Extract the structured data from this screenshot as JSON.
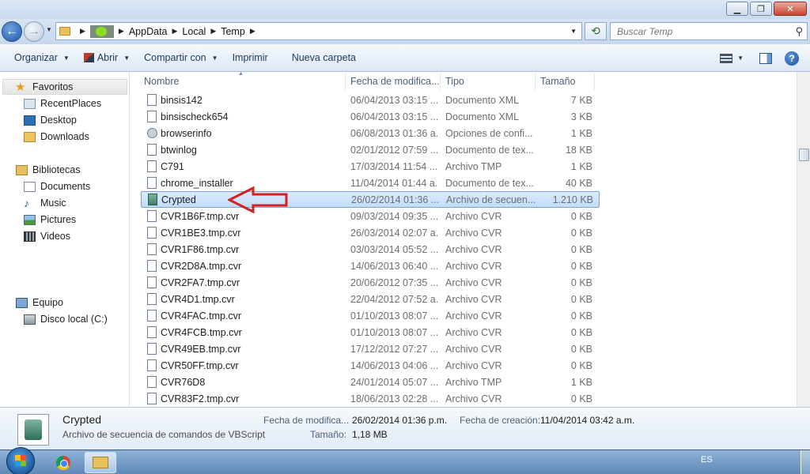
{
  "window": {
    "controls": [
      "minimize",
      "maximize",
      "close"
    ]
  },
  "address": {
    "crumbs": [
      "AppData",
      "Local",
      "Temp"
    ],
    "search_placeholder": "Buscar Temp"
  },
  "toolbar": {
    "organizar": "Organizar",
    "abrir": "Abrir",
    "compartir": "Compartir con",
    "imprimir": "Imprimir",
    "nueva_carpeta": "Nueva carpeta"
  },
  "nav": {
    "favoritos": "Favoritos",
    "recent": "RecentPlaces",
    "desktop": "Desktop",
    "downloads": "Downloads",
    "bibliotecas": "Bibliotecas",
    "documents": "Documents",
    "music": "Music",
    "pictures": "Pictures",
    "videos": "Videos",
    "equipo": "Equipo",
    "disco": "Disco local (C:)"
  },
  "columns": {
    "name": "Nombre",
    "date": "Fecha de modifica...",
    "type": "Tipo",
    "size": "Tamaño"
  },
  "files": [
    {
      "name": "binsis142",
      "date": "06/04/2013 03:15 ...",
      "type": "Documento XML",
      "size": "7 KB",
      "icon": "xml-file-icon"
    },
    {
      "name": "binsischeck654",
      "date": "06/04/2013 03:15 ...",
      "type": "Documento XML",
      "size": "3 KB",
      "icon": "xml-file-icon"
    },
    {
      "name": "browserinfo",
      "date": "06/08/2013 01:36 a...",
      "type": "Opciones de confi...",
      "size": "1 KB",
      "icon": "config-file-icon"
    },
    {
      "name": "btwinlog",
      "date": "02/01/2012 07:59 ...",
      "type": "Documento de tex...",
      "size": "18 KB",
      "icon": "text-file-icon"
    },
    {
      "name": "C791",
      "date": "17/03/2014 11:54 ...",
      "type": "Archivo TMP",
      "size": "1 KB",
      "icon": "tmp-file-icon"
    },
    {
      "name": "chrome_installer",
      "date": "11/04/2014 01:44 a...",
      "type": "Documento de tex...",
      "size": "40 KB",
      "icon": "text-file-icon"
    },
    {
      "name": "Crypted",
      "date": "26/02/2014 01:36 ...",
      "type": "Archivo de secuen...",
      "size": "1.210 KB",
      "icon": "vbscript-file-icon"
    },
    {
      "name": "CVR1B6F.tmp.cvr",
      "date": "09/03/2014 09:35 ...",
      "type": "Archivo CVR",
      "size": "0 KB",
      "icon": "blank-file-icon"
    },
    {
      "name": "CVR1BE3.tmp.cvr",
      "date": "26/03/2014 02:07 a...",
      "type": "Archivo CVR",
      "size": "0 KB",
      "icon": "blank-file-icon"
    },
    {
      "name": "CVR1F86.tmp.cvr",
      "date": "03/03/2014 05:52 ...",
      "type": "Archivo CVR",
      "size": "0 KB",
      "icon": "blank-file-icon"
    },
    {
      "name": "CVR2D8A.tmp.cvr",
      "date": "14/06/2013 06:40 ...",
      "type": "Archivo CVR",
      "size": "0 KB",
      "icon": "blank-file-icon"
    },
    {
      "name": "CVR2FA7.tmp.cvr",
      "date": "20/06/2012 07:35 ...",
      "type": "Archivo CVR",
      "size": "0 KB",
      "icon": "blank-file-icon"
    },
    {
      "name": "CVR4D1.tmp.cvr",
      "date": "22/04/2012 07:52 a...",
      "type": "Archivo CVR",
      "size": "0 KB",
      "icon": "blank-file-icon"
    },
    {
      "name": "CVR4FAC.tmp.cvr",
      "date": "01/10/2013 08:07 ...",
      "type": "Archivo CVR",
      "size": "0 KB",
      "icon": "blank-file-icon"
    },
    {
      "name": "CVR4FCB.tmp.cvr",
      "date": "01/10/2013 08:07 ...",
      "type": "Archivo CVR",
      "size": "0 KB",
      "icon": "blank-file-icon"
    },
    {
      "name": "CVR49EB.tmp.cvr",
      "date": "17/12/2012 07:27 ...",
      "type": "Archivo CVR",
      "size": "0 KB",
      "icon": "blank-file-icon"
    },
    {
      "name": "CVR50FF.tmp.cvr",
      "date": "14/06/2013 04:06 ...",
      "type": "Archivo CVR",
      "size": "0 KB",
      "icon": "blank-file-icon"
    },
    {
      "name": "CVR76D8",
      "date": "24/01/2014 05:07 ...",
      "type": "Archivo TMP",
      "size": "1 KB",
      "icon": "tmp-file-icon"
    },
    {
      "name": "CVR83F2.tmp.cvr",
      "date": "18/06/2013 02:28 ...",
      "type": "Archivo CVR",
      "size": "0 KB",
      "icon": "blank-file-icon"
    }
  ],
  "selected_index": 6,
  "details": {
    "name": "Crypted",
    "desc": "Archivo de secuencia de comandos de VBScript",
    "mod_label": "Fecha de modifica...",
    "mod_value": "26/02/2014 01:36 p.m.",
    "size_label": "Tamaño:",
    "size_value": "1,18 MB",
    "created_label": "Fecha de creación:",
    "created_value": "11/04/2014 03:42 a.m."
  },
  "taskbar": {
    "lang": "ES"
  },
  "colors": {
    "selection": "#cce4fc",
    "annotation_arrow": "#d42020"
  }
}
